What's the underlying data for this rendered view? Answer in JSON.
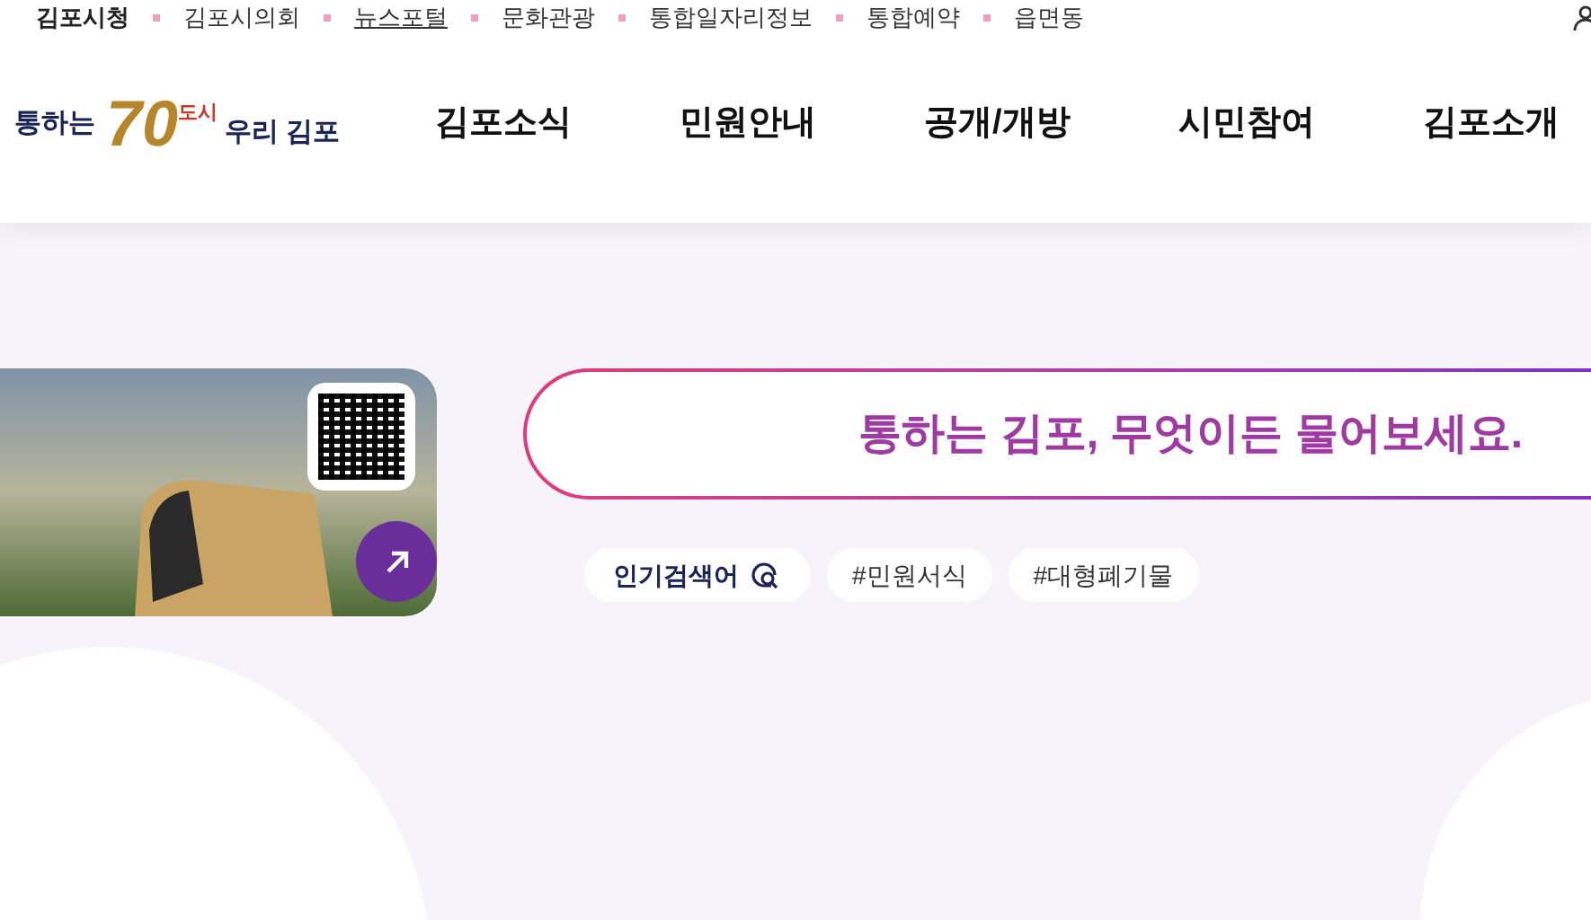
{
  "top_links": [
    {
      "label": "김포시청",
      "selected": true
    },
    {
      "label": "김포시의회",
      "selected": false
    },
    {
      "label": "뉴스포털",
      "selected": false,
      "underlined": true
    },
    {
      "label": "문화관광",
      "selected": false
    },
    {
      "label": "통합일자리정보",
      "selected": false
    },
    {
      "label": "통합예약",
      "selected": false
    },
    {
      "label": "읍면동",
      "selected": false
    }
  ],
  "logo": {
    "prefix": "통하는",
    "number": "70",
    "badge": "도시",
    "suffix": "우리 김포"
  },
  "nav": [
    "김포소식",
    "민원안내",
    "공개/개방",
    "시민참여",
    "김포소개"
  ],
  "search": {
    "placeholder": "통하는 김포, 무엇이든 물어보세요."
  },
  "popular": {
    "label": "인기검색어",
    "tags": [
      "#민원서식",
      "#대형폐기물"
    ]
  }
}
